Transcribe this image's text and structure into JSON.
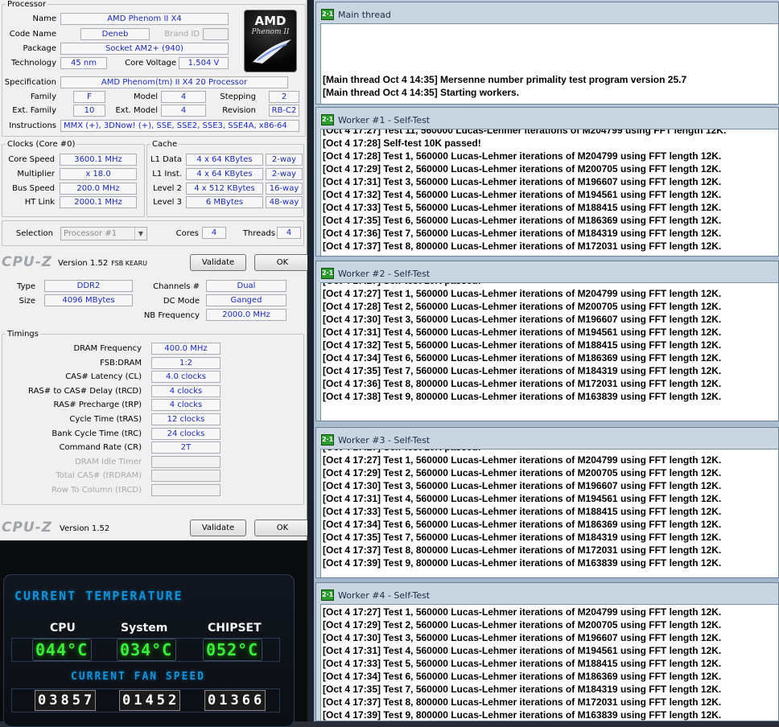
{
  "cpuz_top": {
    "processor_legend": "Processor",
    "name_label": "Name",
    "name": "AMD Phenom II X4",
    "codename_label": "Code Name",
    "codename": "Deneb",
    "brandid_label": "Brand ID",
    "package_label": "Package",
    "package": "Socket AM2+ (940)",
    "technology_label": "Technology",
    "technology": "45 nm",
    "corevoltage_label": "Core Voltage",
    "corevoltage": "1.504 V",
    "spec_label": "Specification",
    "spec": "AMD Phenom(tm) II X4 20 Processor",
    "family_label": "Family",
    "family": "F",
    "model_label": "Model",
    "model": "4",
    "stepping_label": "Stepping",
    "stepping": "2",
    "extfamily_label": "Ext. Family",
    "extfamily": "10",
    "extmodel_label": "Ext. Model",
    "extmodel": "4",
    "revision_label": "Revision",
    "revision": "RB-C2",
    "instructions_label": "Instructions",
    "instructions": "MMX (+), 3DNow! (+), SSE, SSE2, SSE3, SSE4A, x86-64",
    "logo_text1": "AMD",
    "logo_text2": "Phenom II",
    "clocks_legend": "Clocks (Core #0)",
    "corespeed_label": "Core Speed",
    "corespeed": "3600.1 MHz",
    "multiplier_label": "Multiplier",
    "multiplier": "x 18.0",
    "busspeed_label": "Bus Speed",
    "busspeed": "200.0 MHz",
    "htlink_label": "HT Link",
    "htlink": "2000.1 MHz",
    "cache_legend": "Cache",
    "l1data_label": "L1 Data",
    "l1data": "4 x 64 KBytes",
    "l1data_way": "2-way",
    "l1inst_label": "L1 Inst.",
    "l1inst": "4 x 64 KBytes",
    "l1inst_way": "2-way",
    "level2_label": "Level 2",
    "level2": "4 x 512 KBytes",
    "level2_way": "16-way",
    "level3_label": "Level 3",
    "level3": "6 MBytes",
    "level3_way": "48-way",
    "selection_label": "Selection",
    "selection": "Processor #1",
    "cores_label": "Cores",
    "cores": "4",
    "threads_label": "Threads",
    "threads": "4",
    "brand": "CPU-Z",
    "version": "Version 1.52",
    "fsb_tag": "FSB KEARU",
    "validate": "Validate",
    "ok": "OK"
  },
  "cpuz_mem": {
    "type_label": "Type",
    "type": "DDR2",
    "channels_label": "Channels #",
    "channels": "Dual",
    "size_label": "Size",
    "size": "4096 MBytes",
    "dcmode_label": "DC Mode",
    "dcmode": "Ganged",
    "nbfreq_label": "NB Frequency",
    "nbfreq": "2000.0 MHz",
    "timings_legend": "Timings",
    "timings": [
      {
        "label": "DRAM Frequency",
        "value": "400.0 MHz"
      },
      {
        "label": "FSB:DRAM",
        "value": "1:2"
      },
      {
        "label": "CAS# Latency (CL)",
        "value": "4.0 clocks"
      },
      {
        "label": "RAS# to CAS# Delay (tRCD)",
        "value": "4 clocks"
      },
      {
        "label": "RAS# Precharge (tRP)",
        "value": "4 clocks"
      },
      {
        "label": "Cycle Time (tRAS)",
        "value": "12 clocks"
      },
      {
        "label": "Bank Cycle Time (tRC)",
        "value": "24 clocks"
      },
      {
        "label": "Command Rate (CR)",
        "value": "2T"
      },
      {
        "label": "DRAM Idle Timer",
        "value": ""
      },
      {
        "label": "Total CAS# (tRDRAM)",
        "value": ""
      },
      {
        "label": "Row To Column (tRCD)",
        "value": ""
      }
    ],
    "brand": "CPU-Z",
    "version": "Version 1.52",
    "validate": "Validate",
    "ok": "OK"
  },
  "temperature": {
    "title": "CURRENT TEMPERATURE",
    "cpu_label": "CPU",
    "system_label": "System",
    "chipset_label": "CHIPSET",
    "cpu_temp": "044°C",
    "system_temp": "034°C",
    "chipset_temp": "052°C",
    "fan_title": "CURRENT FAN SPEED",
    "fan1": "03857",
    "fan2": "01452",
    "fan3": "01366"
  },
  "prime95": {
    "main": {
      "title": "Main thread",
      "lines": [
        "[Main thread Oct 4 14:35] Mersenne number primality test program version 25.7",
        "[Main thread Oct 4 14:35] Starting workers."
      ]
    },
    "w1": {
      "title": "Worker #1 - Self-Test",
      "lines": [
        "[Oct 4 17:27] Test 11, 560000 Lucas-Lehmer iterations of M204799 using FFT length 12K.",
        "[Oct 4 17:28] Self-test 10K passed!",
        "[Oct 4 17:28] Test 1, 560000 Lucas-Lehmer iterations of M204799 using FFT length 12K.",
        "[Oct 4 17:29] Test 2, 560000 Lucas-Lehmer iterations of M200705 using FFT length 12K.",
        "[Oct 4 17:31] Test 3, 560000 Lucas-Lehmer iterations of M196607 using FFT length 12K.",
        "[Oct 4 17:32] Test 4, 560000 Lucas-Lehmer iterations of M194561 using FFT length 12K.",
        "[Oct 4 17:33] Test 5, 560000 Lucas-Lehmer iterations of M188415 using FFT length 12K.",
        "[Oct 4 17:35] Test 6, 560000 Lucas-Lehmer iterations of M186369 using FFT length 12K.",
        "[Oct 4 17:36] Test 7, 560000 Lucas-Lehmer iterations of M184319 using FFT length 12K.",
        "[Oct 4 17:37] Test 8, 800000 Lucas-Lehmer iterations of M172031 using FFT length 12K."
      ]
    },
    "w2": {
      "title": "Worker #2 - Self-Test",
      "lines": [
        "[Oct 4 17:27] Self-test 10K passed!",
        "[Oct 4 17:27] Test 1, 560000 Lucas-Lehmer iterations of M204799 using FFT length 12K.",
        "[Oct 4 17:28] Test 2, 560000 Lucas-Lehmer iterations of M200705 using FFT length 12K.",
        "[Oct 4 17:30] Test 3, 560000 Lucas-Lehmer iterations of M196607 using FFT length 12K.",
        "[Oct 4 17:31] Test 4, 560000 Lucas-Lehmer iterations of M194561 using FFT length 12K.",
        "[Oct 4 17:32] Test 5, 560000 Lucas-Lehmer iterations of M188415 using FFT length 12K.",
        "[Oct 4 17:34] Test 6, 560000 Lucas-Lehmer iterations of M186369 using FFT length 12K.",
        "[Oct 4 17:35] Test 7, 560000 Lucas-Lehmer iterations of M184319 using FFT length 12K.",
        "[Oct 4 17:36] Test 8, 800000 Lucas-Lehmer iterations of M172031 using FFT length 12K.",
        "[Oct 4 17:38] Test 9, 800000 Lucas-Lehmer iterations of M163839 using FFT length 12K."
      ]
    },
    "w3": {
      "title": "Worker #3 - Self-Test",
      "lines": [
        "[Oct 4 17:27] Self-test 10K passed!",
        "[Oct 4 17:27] Test 1, 560000 Lucas-Lehmer iterations of M204799 using FFT length 12K.",
        "[Oct 4 17:29] Test 2, 560000 Lucas-Lehmer iterations of M200705 using FFT length 12K.",
        "[Oct 4 17:30] Test 3, 560000 Lucas-Lehmer iterations of M196607 using FFT length 12K.",
        "[Oct 4 17:31] Test 4, 560000 Lucas-Lehmer iterations of M194561 using FFT length 12K.",
        "[Oct 4 17:33] Test 5, 560000 Lucas-Lehmer iterations of M188415 using FFT length 12K.",
        "[Oct 4 17:34] Test 6, 560000 Lucas-Lehmer iterations of M186369 using FFT length 12K.",
        "[Oct 4 17:35] Test 7, 560000 Lucas-Lehmer iterations of M184319 using FFT length 12K.",
        "[Oct 4 17:37] Test 8, 800000 Lucas-Lehmer iterations of M172031 using FFT length 12K.",
        "[Oct 4 17:39] Test 9, 800000 Lucas-Lehmer iterations of M163839 using FFT length 12K."
      ]
    },
    "w4": {
      "title": "Worker #4 - Self-Test",
      "lines": [
        "[Oct 4 17:27] Test 1, 560000 Lucas-Lehmer iterations of M204799 using FFT length 12K.",
        "[Oct 4 17:29] Test 2, 560000 Lucas-Lehmer iterations of M200705 using FFT length 12K.",
        "[Oct 4 17:30] Test 3, 560000 Lucas-Lehmer iterations of M196607 using FFT length 12K.",
        "[Oct 4 17:31] Test 4, 560000 Lucas-Lehmer iterations of M194561 using FFT length 12K.",
        "[Oct 4 17:33] Test 5, 560000 Lucas-Lehmer iterations of M188415 using FFT length 12K.",
        "[Oct 4 17:34] Test 6, 560000 Lucas-Lehmer iterations of M186369 using FFT length 12K.",
        "[Oct 4 17:35] Test 7, 560000 Lucas-Lehmer iterations of M184319 using FFT length 12K.",
        "[Oct 4 17:37] Test 8, 800000 Lucas-Lehmer iterations of M172031 using FFT length 12K.",
        "[Oct 4 17:39] Test 9, 800000 Lucas-Lehmer iterations of M163839 using FFT length 12K."
      ]
    }
  }
}
